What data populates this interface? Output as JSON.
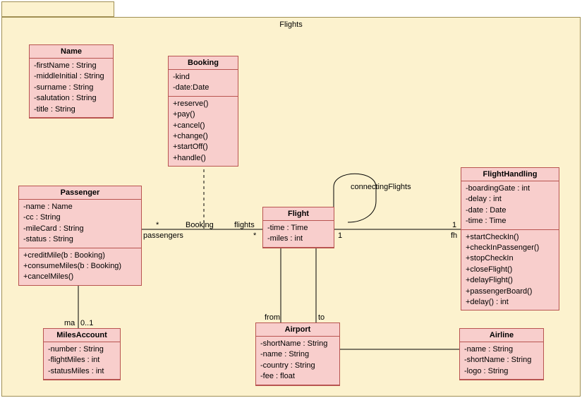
{
  "package": {
    "title": "Flights"
  },
  "classes": {
    "name": {
      "title": "Name",
      "attrs": [
        "-firstName : String",
        "-middleInitial : String",
        "-surname : String",
        "-salutation : String",
        "-title : String"
      ]
    },
    "booking": {
      "title": "Booking",
      "attrs": [
        "-kind",
        "-date:Date"
      ],
      "ops": [
        "+reserve()",
        "+pay()",
        "+cancel()",
        "+change()",
        "+startOff()",
        "+handle()"
      ]
    },
    "passenger": {
      "title": "Passenger",
      "attrs": [
        "-name : Name",
        "-cc : String",
        "-mileCard : String",
        "-status : String"
      ],
      "ops": [
        "+creditMile(b : Booking)",
        "+consumeMiles(b : Booking)",
        "+cancelMiles()"
      ]
    },
    "flightHandling": {
      "title": "FlightHandling",
      "attrs": [
        "-boardingGate : int",
        "-delay : int",
        "-date : Date",
        "-time : Time"
      ],
      "ops": [
        "+startCheckIn()",
        "+checkInPassenger()",
        "+stopCheckIn",
        "+closeFlight()",
        "+delayFlight()",
        "+passengerBoard()",
        "+delay() : int"
      ]
    },
    "flight": {
      "title": "Flight",
      "attrs": [
        "-time : Time",
        "-miles : int"
      ]
    },
    "milesAccount": {
      "title": "MilesAccount",
      "attrs": [
        "-number : String",
        "-flightMiles : int",
        "-statusMiles : int"
      ]
    },
    "airport": {
      "title": "Airport",
      "attrs": [
        "-shortName : String",
        "-name : String",
        "-country : String",
        "-fee : float"
      ]
    },
    "airline": {
      "title": "Airline",
      "attrs": [
        "-name : String",
        "-shortName : String",
        "-logo : String"
      ]
    }
  },
  "labels": {
    "passengers": "passengers",
    "bookingAssoc": "Booking",
    "flights": "flights",
    "connecting": "connectingFlights",
    "from": "from",
    "to": "to",
    "ma": "ma",
    "zeroOne": "0..1",
    "starL": "*",
    "starR": "*",
    "one1": "1",
    "one2": "1",
    "fh": "fh"
  },
  "chart_data": {
    "type": "uml-class-diagram",
    "package": "Flights",
    "classes": [
      {
        "name": "Name",
        "attributes": [
          "firstName:String",
          "middleInitial:String",
          "surname:String",
          "salutation:String",
          "title:String"
        ],
        "operations": []
      },
      {
        "name": "Booking",
        "attributes": [
          "kind",
          "date:Date"
        ],
        "operations": [
          "reserve()",
          "pay()",
          "cancel()",
          "change()",
          "startOff()",
          "handle()"
        ]
      },
      {
        "name": "Passenger",
        "attributes": [
          "name:Name",
          "cc:String",
          "mileCard:String",
          "status:String"
        ],
        "operations": [
          "creditMile(b:Booking)",
          "consumeMiles(b:Booking)",
          "cancelMiles()"
        ]
      },
      {
        "name": "FlightHandling",
        "attributes": [
          "boardingGate:int",
          "delay:int",
          "date:Date",
          "time:Time"
        ],
        "operations": [
          "startCheckIn()",
          "checkInPassenger()",
          "stopCheckIn",
          "closeFlight()",
          "delayFlight()",
          "passengerBoard()",
          "delay():int"
        ]
      },
      {
        "name": "Flight",
        "attributes": [
          "time:Time",
          "miles:int"
        ],
        "operations": []
      },
      {
        "name": "MilesAccount",
        "attributes": [
          "number:String",
          "flightMiles:int",
          "statusMiles:int"
        ],
        "operations": []
      },
      {
        "name": "Airport",
        "attributes": [
          "shortName:String",
          "name:String",
          "country:String",
          "fee:float"
        ],
        "operations": []
      },
      {
        "name": "Airline",
        "attributes": [
          "name:String",
          "shortName:String",
          "logo:String"
        ],
        "operations": []
      }
    ],
    "associations": [
      {
        "from": "Passenger",
        "to": "Flight",
        "fromMult": "*",
        "toMult": "*",
        "fromRole": "passengers",
        "toRole": "flights",
        "associationClass": "Booking"
      },
      {
        "from": "Flight",
        "to": "FlightHandling",
        "fromMult": "1",
        "toMult": "1",
        "toRole": "fh"
      },
      {
        "from": "Passenger",
        "to": "MilesAccount",
        "toMult": "0..1",
        "toRole": "ma"
      },
      {
        "from": "Flight",
        "to": "Airport",
        "role": "from"
      },
      {
        "from": "Flight",
        "to": "Airport",
        "role": "to"
      },
      {
        "from": "Airport",
        "to": "Airline"
      },
      {
        "from": "Flight",
        "to": "Flight",
        "name": "connectingFlights",
        "self": true
      }
    ]
  }
}
